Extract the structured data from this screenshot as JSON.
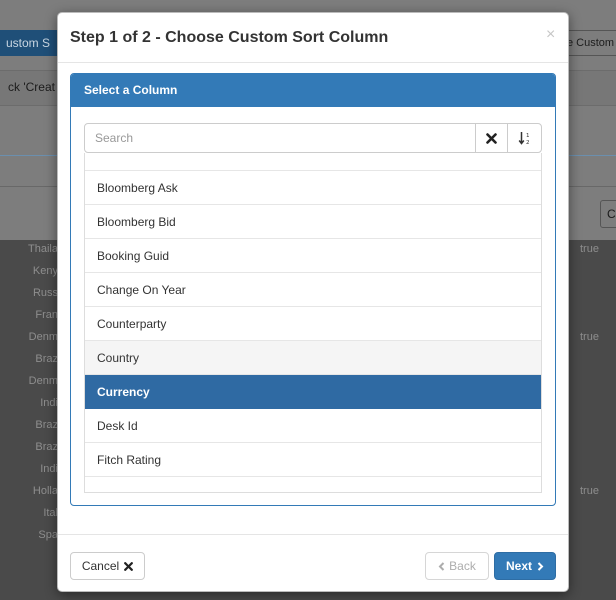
{
  "background": {
    "left_button": "ustom S",
    "right_button": "e Custom S",
    "strip_text": "ck 'Creat",
    "right_small_button": "C",
    "rows": [
      {
        "country": "Thaila",
        "flag": "true"
      },
      {
        "country": "Keny",
        "flag": ""
      },
      {
        "country": "Russ",
        "flag": ""
      },
      {
        "country": "Fran",
        "flag": ""
      },
      {
        "country": "Denm",
        "flag": "true"
      },
      {
        "country": "Braz",
        "flag": ""
      },
      {
        "country": "Denm",
        "flag": ""
      },
      {
        "country": "Indi",
        "flag": ""
      },
      {
        "country": "Braz",
        "flag": ""
      },
      {
        "country": "Braz",
        "flag": ""
      },
      {
        "country": "Indi",
        "flag": ""
      },
      {
        "country": "Holla",
        "flag": "true"
      },
      {
        "country": "Ital",
        "flag": ""
      },
      {
        "country": "Spa",
        "flag": ""
      }
    ]
  },
  "modal": {
    "title": "Step 1 of 2 - Choose Custom Sort Column",
    "close_symbol": "×",
    "panel_title": "Select a Column",
    "search_placeholder": "Search",
    "columns": [
      {
        "label": "Bloomberg Ask",
        "state": ""
      },
      {
        "label": "Bloomberg Bid",
        "state": ""
      },
      {
        "label": "Booking Guid",
        "state": ""
      },
      {
        "label": "Change On Year",
        "state": ""
      },
      {
        "label": "Counterparty",
        "state": ""
      },
      {
        "label": "Country",
        "state": "hover"
      },
      {
        "label": "Currency",
        "state": "active"
      },
      {
        "label": "Desk Id",
        "state": ""
      },
      {
        "label": "Fitch Rating",
        "state": ""
      }
    ],
    "cancel_label": "Cancel",
    "back_label": "Back",
    "next_label": "Next"
  },
  "colors": {
    "primary": "#337ab7",
    "active_row": "#2f6aa3",
    "overlay": "#4a4a4a"
  }
}
